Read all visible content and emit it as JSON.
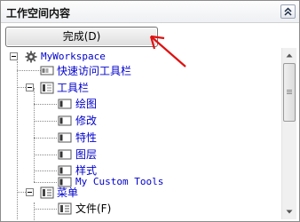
{
  "panel": {
    "title": "工作空间内容",
    "done_button": "完成(D)"
  },
  "tree": {
    "root": "MyWorkspace",
    "items": [
      {
        "label": "快速访问工具栏"
      },
      {
        "label": "工具栏"
      },
      {
        "label": "绘图"
      },
      {
        "label": "修改"
      },
      {
        "label": "特性"
      },
      {
        "label": "图层"
      },
      {
        "label": "样式"
      },
      {
        "label": "My Custom Tools"
      },
      {
        "label": "菜单"
      },
      {
        "label": "文件(F)"
      }
    ]
  },
  "colors": {
    "tree_text": "#0000cc",
    "annotation_arrow": "#e01010"
  },
  "icons": {
    "workspace": "gear-icon",
    "toolbar": "toolbar-icon",
    "menu": "menu-icon",
    "collapse": "double-chevron-up-icon",
    "annotation": "red-arrow-icon"
  }
}
